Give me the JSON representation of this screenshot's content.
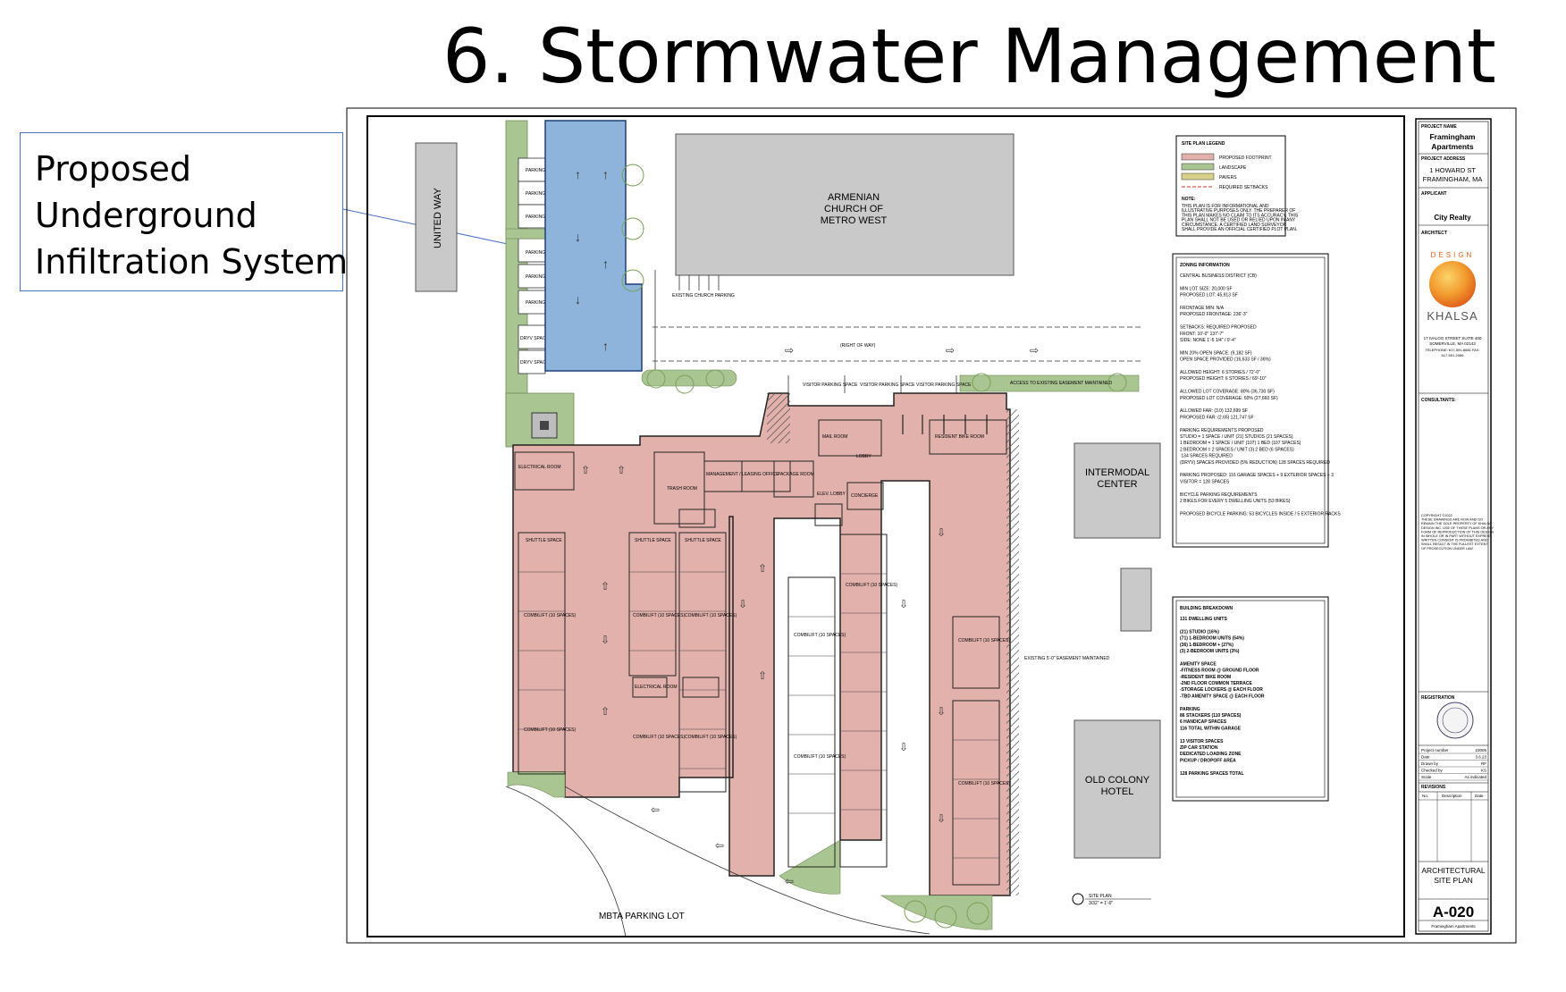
{
  "slide": {
    "title": "6. Stormwater Management",
    "callout": {
      "line1": "Proposed",
      "line2": "Underground",
      "line3": "Infiltration System"
    }
  },
  "colors": {
    "infiltration": "#8eb4dc",
    "footprint": "#e3b1ab",
    "landscape": "#a9c591",
    "building": "#c9c9c9",
    "callout_border": "#4a72c4"
  },
  "plan": {
    "neighbors": {
      "united_way": "UNITED WAY",
      "armenian_church": [
        "ARMENIAN",
        "CHURCH OF",
        "METRO WEST"
      ],
      "intermodal": [
        "INTERMODAL",
        "CENTER"
      ],
      "old_colony": [
        "OLD COLONY",
        "HOTEL"
      ],
      "mbta": "MBTA PARKING LOT"
    },
    "labels": {
      "parking": "PARKING",
      "dryv_space": "DRYV SPACE",
      "right_of_way": "(RIGHT OF WAY)",
      "existing_church_parking": "EXISTING CHURCH PARKING",
      "visitor_parking": "VISITOR PARKING SPACE",
      "access_easement": "ACCESS TO EXISTING EASEMENT MAINTAINED",
      "easement": "EXISTING 5'-0\" EASEMENT MAINTAINED",
      "electrical_room": "ELECTRICAL ROOM",
      "trash_room": "TRASH ROOM",
      "management": "MANAGEMENT / LEASING OFFICE",
      "package_room": "PACKAGE ROOM",
      "mail_room": "MAIL ROOM",
      "lobby": "LOBBY",
      "elev_lobby": "ELEV. LOBBY",
      "concierge": "CONCIERGE",
      "resident_bike_room": "RESIDENT BIKE ROOM",
      "shuttle_space": "SHUTTLE SPACE",
      "combilift": "COMBILIFT (10 SPACES)",
      "site_plan": "SITE PLAN",
      "scale": "3/32\" = 1'-0\""
    },
    "legend": {
      "title": "SITE PLAN LEGEND",
      "items": [
        {
          "label": "PROPOSED FOOTPRINT",
          "color": "#e3b1ab"
        },
        {
          "label": "LANDSCAPE",
          "color": "#a9c591"
        },
        {
          "label": "PAVERS",
          "color": "#d7d08a"
        },
        {
          "label": "REQUIRED SETBACKS",
          "color": "#cc3333"
        }
      ],
      "note_title": "NOTE:",
      "note_lines": [
        "THIS PLAN IS FOR INFORMATIONAL AND",
        "ILLUSTRATIVE PURPOSES ONLY. THE PREPARER OF",
        "THIS PLAN MAKES NO CLAIM TO ITS ACCURACY. THIS",
        "PLAN SHALL NOT BE USED OR RELIED UPON IN ANY",
        "CIRCUMSTANCE. A CERTIFIED LAND SURVEYOR",
        "SHALL PROVIDE AN OFFICIAL CERTIFIED PLOT PLAN."
      ]
    },
    "zoning": {
      "title": "ZONING INFORMATION",
      "lines": [
        "CENTRAL BUSINESS DISTRICT (CB)",
        "",
        "MIN LOT SIZE: 20,000 SF",
        "PROPOSED LOT: 45,913 SF",
        "",
        "FRONTAGE MIN: N/A",
        "PROPOSED FRONTAGE: 236'-3\"",
        "",
        "SETBACKS:       REQUIRED        PROPOSED",
        "FRONT:          10'-0\"           137'-7\"",
        "SIDE:           NONE            1'-5 1/4\" / 0'-4\"",
        "",
        "MIN 20% OPEN SPACE: (9,182 SF)",
        "OPEN SPACE PROVIDED (16,633 SF / 36%)",
        "",
        "ALLOWED HEIGHT: 6 STORIES / 72'-0\"",
        "PROPOSED HEIGHT: 6 STORIES / 69'-10\"",
        "",
        "ALLOWED LOT COVERAGE: 80% (36,730 SF)",
        "PROPOSED LOT COVERAGE: 60% (27,660 SF)",
        "",
        "ALLOWED FAR: (3.0) 132,699 SF",
        "PROPOSED FAR: (2.65) 121,747 SF",
        "",
        "PARKING REQUIREMENTS                  PROPOSED",
        "STUDIO = 1 SPACE / UNIT              (21) STUDIOS (21 SPACES)",
        "1 BEDROOM = 1 SPACE / UNIT           (107) 1 BED (107 SPACES)",
        "2 BEDROOM = 2 SPACES / UNIT          (3) 2 BED   (6 SPACES)",
        "                                     134 SPACES REQUIRED",
        "(DRYV) SPACES PROVIDED (5% REDUCTION) 128 SPACES REQUIRED",
        "",
        "PARKING PROPOSED: 116 GARAGE SPACES + 9 EXTERIOR SPACES + 3",
        "VISITOR = 128 SPACES",
        "",
        "BICYCLE PARKING REQUIREMENTS",
        "2 BIKES FOR EVERY 5 DWELLING UNITS (53 BIKES)",
        "",
        "PROPOSED BICYCLE PARKING: 53 BICYCLES INSIDE / 5 EXTERIOR RACKS"
      ]
    },
    "building_breakdown": {
      "title": "BUILDING BREAKDOWN",
      "lines": [
        "131 DWELLING UNITS",
        "",
        "(21)   STUDIO                  (16%)",
        "(71)   1-BEDROOM UNITS         (54%)",
        "(36)   1-BEDROOM +             (27%)",
        "(3)    2-BEDROOM UNITS         (3%)",
        "",
        "AMENITY SPACE",
        "-FITNESS ROOM @ GROUND FLOOR",
        "-RESIDENT BIKE ROOM",
        "-2ND FLOOR COMMON TERRACE",
        "-STORAGE LOCKERS @ EACH FLOOR",
        "-TBD AMENITY SPACE @ EACH FLOOR",
        "",
        "PARKING",
        "86 STACKERS (110 SPACES)",
        "6 HANDICAP SPACES",
        "116 TOTAL WITHIN GARAGE",
        "",
        "13 VISITOR SPACES",
        "ZIP CAR STATION",
        "DEDICATED LOADING ZONE",
        "PICKUP / DROPOFF AREA",
        "",
        "128 PARKING SPACES TOTAL"
      ]
    },
    "title_block": {
      "project_name_label": "PROJECT NAME",
      "project_name": [
        "Framingham",
        "Apartments"
      ],
      "project_address_label": "PROJECT ADDRESS",
      "project_address": [
        "1 HOWARD ST",
        "FRAMINGHAM, MA"
      ],
      "applicant_label": "APPLICANT",
      "applicant": "City Realty",
      "architect_label": "ARCHITECT",
      "logo_word": "DESIGN",
      "logo_name": "KHALSA",
      "architect_address": [
        "17 IVALOO STREET SUITE 400",
        "SOMERVILLE, MA 02143"
      ],
      "architect_phone": [
        "TELEPHONE: 617-591-8682 FAX:",
        "617-591-2086"
      ],
      "consultants_label": "CONSULTANTS:",
      "copyright": [
        "COPYRIGHT ©2022",
        "THESE DRAWINGS ARE NOW AND DO",
        "REMAIN THE SOLE PROPERTY OF KHALSA",
        "DESIGN INC. USE OF THESE PLANS OR ANY",
        "FORM OF REPRODUCTION OF THIS DESIGN",
        "IN WHOLE OR IN PART WITHOUT EXPRESS",
        "WRITTEN CONSENT IS PROHIBITED AND",
        "SHALL RESULT IN THE FULLEST EXTENT",
        "OF PROSECUTION UNDER LAW"
      ],
      "registration_label": "REGISTRATION",
      "info": [
        {
          "k": "Project number",
          "v": "23005"
        },
        {
          "k": "Date",
          "v": "3.6.23"
        },
        {
          "k": "Drawn by",
          "v": "RF"
        },
        {
          "k": "Checked by",
          "v": "KS"
        },
        {
          "k": "Scale",
          "v": "As indicated"
        }
      ],
      "revisions_label": "REVISIONS",
      "rev_cols": [
        "No.",
        "Description",
        "Date"
      ],
      "sheet_title": [
        "ARCHITECTURAL",
        "SITE PLAN"
      ],
      "sheet_number": "A-020",
      "sheet_project": "Framingham Apartments"
    }
  }
}
